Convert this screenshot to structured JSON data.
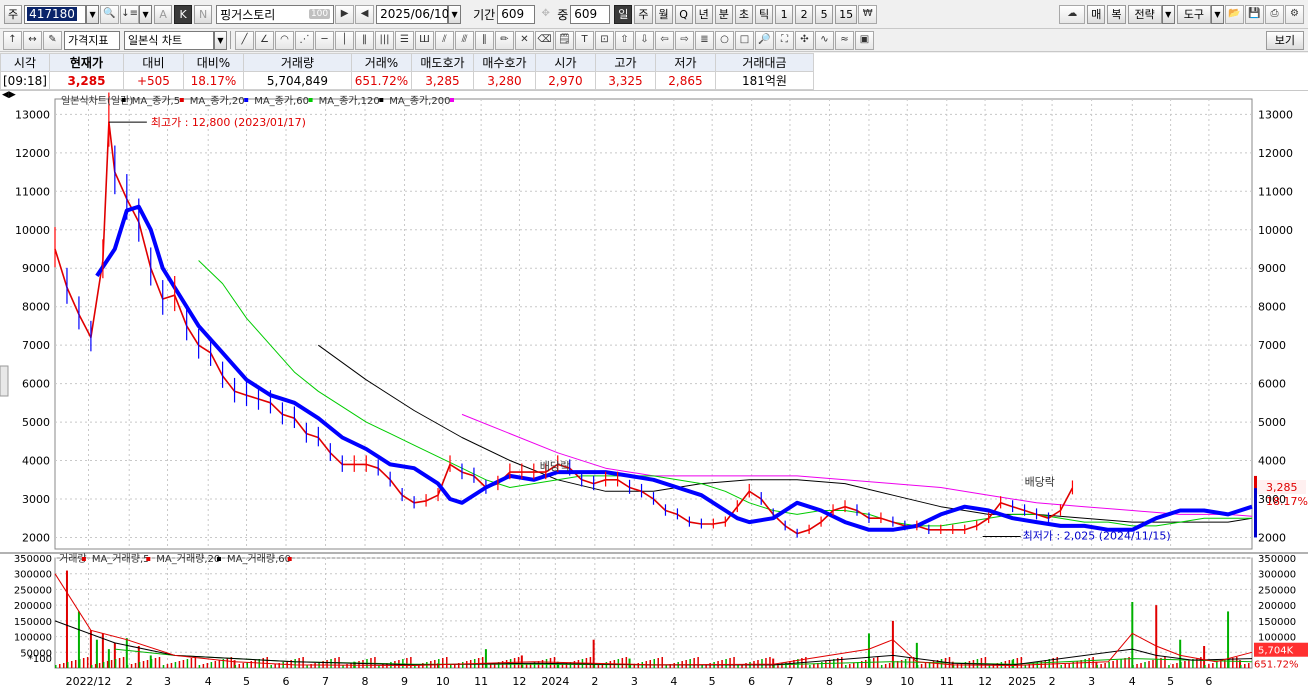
{
  "toolbar": {
    "market_label": "주",
    "code": "417180",
    "name": "핑거스토리",
    "pct_badge": "100",
    "date": "2025/06/10",
    "period_label": "기간",
    "period_value": "609",
    "count_label": "중",
    "count_value": "609",
    "btn_a": "A",
    "btn_k": "K",
    "btn_n": "N",
    "period_buttons": [
      "일",
      "주",
      "월",
      "Q",
      "년",
      "분",
      "초",
      "틱",
      "1",
      "2",
      "5",
      "15"
    ],
    "right_buttons": [
      "매",
      "복",
      "전략",
      "도구"
    ],
    "indicator_select": "가격지표",
    "chart_type_select": "일본식 차트",
    "view_label": "보기"
  },
  "quote": {
    "headers": [
      "시각",
      "현재가",
      "대비",
      "대비%",
      "거래량",
      "거래%",
      "매도호가",
      "매수호가",
      "시가",
      "고가",
      "저가",
      "거래대금"
    ],
    "values": [
      "[09:18]",
      "3,285",
      "+505",
      "18.17%",
      "5,704,849",
      "651.72%",
      "3,285",
      "3,280",
      "2,970",
      "3,325",
      "2,865",
      "181억원"
    ]
  },
  "colors": {
    "up": "#ff0000",
    "down": "#0000ff",
    "ma5": "#e00000",
    "ma20": "#0000ff",
    "ma60": "#00cc00",
    "ma120": "#000000",
    "ma200": "#ee00ee",
    "grid": "#c8c8c8",
    "vol_up": "#e00000",
    "vol_down": "#00b000"
  },
  "chart_data": [
    {
      "type": "line",
      "legend": [
        "일본식차트(일간)",
        "MA_종가,5",
        "MA_종가,20",
        "MA_종가,60",
        "MA_종가,120",
        "MA_종가,200"
      ],
      "ylim": [
        1700,
        13400
      ],
      "yticks": [
        2000,
        3000,
        4000,
        5000,
        6000,
        7000,
        8000,
        9000,
        10000,
        11000,
        12000,
        13000
      ],
      "ytick_labels": [
        "2000",
        "3000",
        "4000",
        "5000",
        "6000",
        "7000",
        "8000",
        "9000",
        "10000",
        "11000",
        "12000",
        "13000"
      ],
      "xlim": [
        0,
        1
      ],
      "x_labels": [
        "2022/12",
        "2",
        "3",
        "4",
        "5",
        "6",
        "7",
        "8",
        "9",
        "10",
        "11",
        "12",
        "2024",
        "2",
        "3",
        "4",
        "5",
        "6",
        "7",
        "8",
        "9",
        "10",
        "11",
        "12",
        "2025",
        "2",
        "3",
        "4",
        "5",
        "6"
      ],
      "x_positions": [
        0.028,
        0.062,
        0.094,
        0.128,
        0.16,
        0.193,
        0.226,
        0.259,
        0.292,
        0.324,
        0.356,
        0.388,
        0.418,
        0.451,
        0.484,
        0.517,
        0.549,
        0.582,
        0.614,
        0.647,
        0.68,
        0.712,
        0.745,
        0.777,
        0.808,
        0.833,
        0.866,
        0.9,
        0.932,
        0.964
      ],
      "price": {
        "x": [
          0.0,
          0.01,
          0.02,
          0.03,
          0.04,
          0.045,
          0.05,
          0.06,
          0.07,
          0.08,
          0.09,
          0.1,
          0.11,
          0.12,
          0.13,
          0.14,
          0.15,
          0.16,
          0.17,
          0.18,
          0.19,
          0.2,
          0.21,
          0.22,
          0.23,
          0.24,
          0.25,
          0.26,
          0.27,
          0.28,
          0.29,
          0.3,
          0.31,
          0.32,
          0.33,
          0.34,
          0.35,
          0.36,
          0.37,
          0.38,
          0.39,
          0.4,
          0.41,
          0.42,
          0.43,
          0.44,
          0.45,
          0.46,
          0.47,
          0.48,
          0.49,
          0.5,
          0.51,
          0.52,
          0.53,
          0.54,
          0.55,
          0.56,
          0.57,
          0.58,
          0.59,
          0.6,
          0.61,
          0.62,
          0.63,
          0.64,
          0.65,
          0.66,
          0.67,
          0.68,
          0.69,
          0.7,
          0.71,
          0.72,
          0.73,
          0.74,
          0.75,
          0.76,
          0.77,
          0.78,
          0.79,
          0.8,
          0.81,
          0.82,
          0.83,
          0.84,
          0.85,
          0.86,
          0.87,
          0.88,
          0.89,
          0.9,
          0.91,
          0.92,
          0.93,
          0.94,
          0.95,
          0.96,
          0.97,
          0.98,
          1.0
        ],
        "y": [
          9500,
          8500,
          7800,
          7200,
          9200,
          12800,
          11500,
          10800,
          10200,
          9000,
          8200,
          8300,
          7500,
          7000,
          6800,
          6200,
          5800,
          5700,
          5600,
          5500,
          5200,
          5100,
          4700,
          4600,
          4200,
          3900,
          3900,
          3900,
          3800,
          3500,
          3100,
          2900,
          2950,
          3100,
          3900,
          3700,
          3600,
          3300,
          3400,
          3700,
          3700,
          3700,
          3700,
          3900,
          3800,
          3500,
          3400,
          3500,
          3500,
          3300,
          3200,
          3000,
          2700,
          2600,
          2400,
          2350,
          2350,
          2400,
          2800,
          3200,
          3000,
          2600,
          2300,
          2100,
          2200,
          2400,
          2700,
          2800,
          2700,
          2500,
          2500,
          2400,
          2300,
          2300,
          2200,
          2200,
          2200,
          2200,
          2300,
          2500,
          2900,
          2800,
          2700,
          2600,
          2500,
          2700,
          3285
        ],
        "note_high": "최고가 : 12,800 (2023/01/17)",
        "note_low": "최저가 : 2,025 (2024/11/15)",
        "note_div": "배당락"
      },
      "ma20": {
        "x": [
          0.035,
          0.05,
          0.06,
          0.07,
          0.08,
          0.09,
          0.1,
          0.12,
          0.14,
          0.16,
          0.18,
          0.2,
          0.22,
          0.24,
          0.26,
          0.28,
          0.3,
          0.32,
          0.33,
          0.34,
          0.36,
          0.38,
          0.4,
          0.42,
          0.44,
          0.46,
          0.48,
          0.5,
          0.52,
          0.54,
          0.56,
          0.57,
          0.58,
          0.6,
          0.62,
          0.64,
          0.66,
          0.68,
          0.7,
          0.72,
          0.74,
          0.76,
          0.78,
          0.8,
          0.82,
          0.84,
          0.86,
          0.88,
          0.9,
          0.92,
          0.94,
          0.96,
          0.98,
          1.0
        ],
        "y": [
          8800,
          9500,
          10500,
          10600,
          10000,
          9000,
          8500,
          7500,
          6800,
          6100,
          5700,
          5500,
          5100,
          4600,
          4300,
          3900,
          3800,
          3400,
          3000,
          2900,
          3300,
          3600,
          3500,
          3700,
          3700,
          3700,
          3600,
          3500,
          3300,
          3100,
          2700,
          2500,
          2400,
          2500,
          2900,
          2700,
          2400,
          2200,
          2200,
          2300,
          2600,
          2800,
          2700,
          2500,
          2400,
          2300,
          2300,
          2200,
          2200,
          2500,
          2700,
          2700,
          2600,
          2800
        ]
      },
      "ma60": {
        "x": [
          0.12,
          0.14,
          0.16,
          0.18,
          0.2,
          0.22,
          0.24,
          0.26,
          0.28,
          0.3,
          0.32,
          0.34,
          0.36,
          0.38,
          0.4,
          0.42,
          0.44,
          0.46,
          0.48,
          0.5,
          0.52,
          0.54,
          0.56,
          0.58,
          0.6,
          0.62,
          0.64,
          0.66,
          0.68,
          0.7,
          0.72,
          0.74,
          0.76,
          0.78,
          0.8,
          0.82,
          0.84,
          0.86,
          0.88,
          0.9,
          0.92,
          0.94,
          0.96,
          0.98,
          1.0
        ],
        "y": [
          9200,
          8600,
          7700,
          7000,
          6300,
          5800,
          5400,
          5000,
          4700,
          4400,
          4100,
          3800,
          3500,
          3300,
          3400,
          3500,
          3600,
          3600,
          3600,
          3600,
          3500,
          3400,
          3200,
          2900,
          2700,
          2600,
          2700,
          2700,
          2600,
          2400,
          2300,
          2300,
          2400,
          2500,
          2600,
          2600,
          2500,
          2400,
          2400,
          2300,
          2300,
          2400,
          2500,
          2500,
          2500
        ]
      },
      "ma120": {
        "x": [
          0.22,
          0.26,
          0.3,
          0.34,
          0.38,
          0.42,
          0.46,
          0.5,
          0.54,
          0.58,
          0.62,
          0.66,
          0.7,
          0.74,
          0.78,
          0.82,
          0.86,
          0.9,
          0.94,
          0.98,
          1.0
        ],
        "y": [
          7000,
          6100,
          5300,
          4600,
          4000,
          3500,
          3200,
          3200,
          3400,
          3500,
          3500,
          3400,
          3100,
          2800,
          2600,
          2600,
          2500,
          2400,
          2400,
          2400,
          2500
        ]
      },
      "ma200": {
        "x": [
          0.34,
          0.38,
          0.42,
          0.46,
          0.5,
          0.54,
          0.58,
          0.62,
          0.66,
          0.7,
          0.74,
          0.78,
          0.82,
          0.86,
          0.9,
          0.94,
          0.98,
          1.0
        ],
        "y": [
          5200,
          4700,
          4200,
          3800,
          3600,
          3600,
          3600,
          3600,
          3500,
          3400,
          3300,
          3100,
          2900,
          2800,
          2700,
          2600,
          2600,
          2550
        ]
      },
      "last_price_label": "3,285",
      "last_pct_label": "18.17%"
    },
    {
      "type": "bar",
      "legend": [
        "거래량",
        "MA_거래량,5",
        "MA_거래량,20",
        "MA_거래량,60"
      ],
      "ylim": [
        0,
        350000
      ],
      "yticks": [
        50000,
        100000,
        150000,
        200000,
        250000,
        300000,
        350000
      ],
      "ytick_labels": [
        "50000",
        "100000",
        "150000",
        "200000",
        "250000",
        "300000",
        "350000"
      ],
      "y_unit_label": "*100",
      "spikes_x": [
        0.01,
        0.02,
        0.03,
        0.035,
        0.04,
        0.045,
        0.05,
        0.06,
        0.07,
        0.08,
        0.15,
        0.25,
        0.32,
        0.36,
        0.39,
        0.42,
        0.45,
        0.48,
        0.6,
        0.68,
        0.7,
        0.72,
        0.75,
        0.8,
        0.87,
        0.9,
        0.92,
        0.94,
        0.96,
        0.98,
        0.99
      ],
      "spikes_v": [
        310000,
        180000,
        120000,
        90000,
        110000,
        60000,
        80000,
        95000,
        70000,
        40000,
        25000,
        20000,
        15000,
        60000,
        40000,
        20000,
        90000,
        30000,
        30000,
        110000,
        150000,
        80000,
        20000,
        25000,
        20000,
        210000,
        200000,
        90000,
        70000,
        180000,
        25000
      ],
      "ma5": {
        "x": [
          0.0,
          0.03,
          0.06,
          0.1,
          0.15,
          0.2,
          0.3,
          0.4,
          0.5,
          0.6,
          0.68,
          0.7,
          0.72,
          0.75,
          0.8,
          0.88,
          0.9,
          0.92,
          0.94,
          0.97,
          1.0
        ],
        "y": [
          300000,
          120000,
          90000,
          40000,
          20000,
          10000,
          8000,
          20000,
          10000,
          12000,
          60000,
          90000,
          20000,
          10000,
          8000,
          20000,
          110000,
          70000,
          40000,
          20000,
          50000
        ]
      },
      "ma20": {
        "x": [
          0.0,
          0.05,
          0.1,
          0.2,
          0.3,
          0.4,
          0.5,
          0.6,
          0.7,
          0.75,
          0.8,
          0.9,
          0.92,
          0.95,
          1.0
        ],
        "y": [
          150000,
          80000,
          40000,
          20000,
          10000,
          15000,
          10000,
          10000,
          40000,
          15000,
          10000,
          60000,
          40000,
          25000,
          30000
        ]
      },
      "ma60": {
        "x": [
          0.05,
          0.1,
          0.2,
          0.3,
          0.4,
          0.5,
          0.6,
          0.7,
          0.8,
          0.9,
          0.95,
          1.0
        ],
        "y": [
          60000,
          40000,
          20000,
          12000,
          12000,
          10000,
          10000,
          20000,
          12000,
          30000,
          25000,
          20000
        ]
      },
      "last_volume_label": "5,704K",
      "last_pct_label": "651.72%"
    }
  ]
}
